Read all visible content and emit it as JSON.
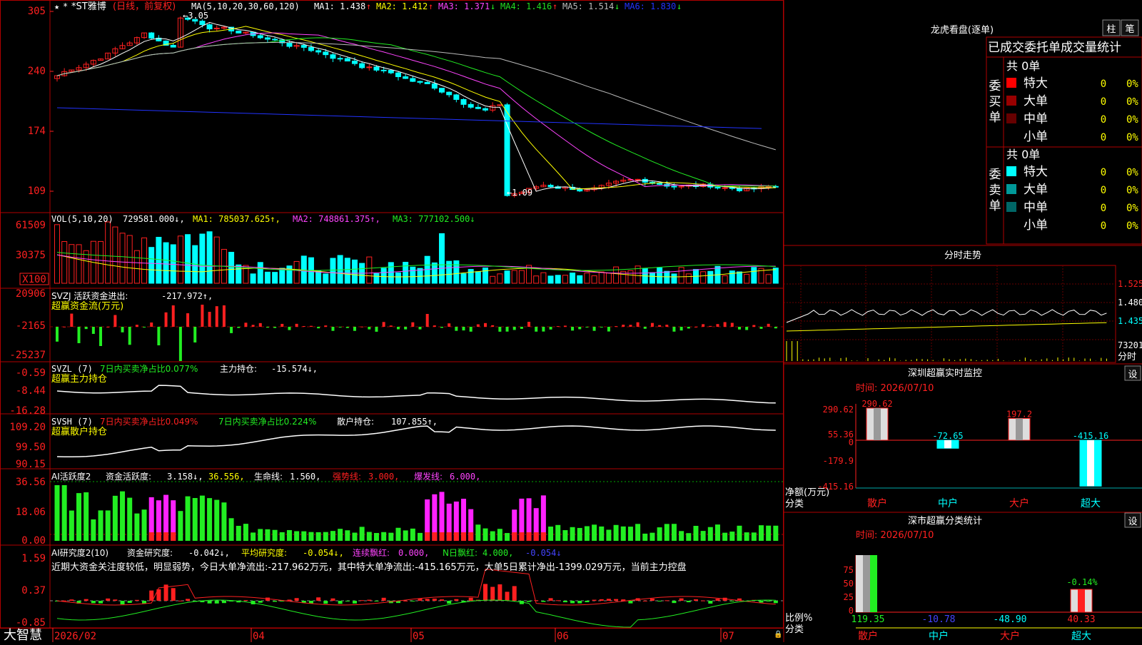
{
  "app": {
    "brand": "大智慧",
    "dates_axis": [
      "2026/02",
      "04",
      "05",
      "06",
      "07"
    ]
  },
  "kline": {
    "title": "*ST雅博",
    "period": "(日线，前复权)",
    "ma_label": "MA(5,10,20,30,60,120)",
    "ma": [
      {
        "label": "MA1:",
        "value": "1.438",
        "arrow": "↑",
        "color": "#ffffff"
      },
      {
        "label": "MA2:",
        "value": "1.412",
        "arrow": "↑",
        "color": "#ffff00"
      },
      {
        "label": "MA3:",
        "value": "1.371",
        "arrow": "↓",
        "color": "#ff44ff"
      },
      {
        "label": "MA4:",
        "value": "1.416",
        "arrow": "↑",
        "color": "#22dd22"
      },
      {
        "label": "MA5:",
        "value": "1.514",
        "arrow": "↓",
        "color": "#bbbbbb"
      },
      {
        "label": "MA6:",
        "value": "1.830",
        "arrow": "↓",
        "color": "#2233ff"
      }
    ],
    "y_ticks": [
      "305",
      "240",
      "174",
      "109"
    ],
    "high_label": "3.05",
    "low_label": "1.09",
    "up_color": "#ff2020",
    "down_color": "#00ffff"
  },
  "volume": {
    "label": "VOL(5,10,20)",
    "value": "729581.000",
    "ma1": "MA1: 785037.625",
    "ma2": "MA2: 748861.375",
    "ma3": "MA3: 777102.500",
    "y_ticks": [
      "61509",
      "30375",
      "X100"
    ]
  },
  "svzj": {
    "label": "SVZJ  活跃资金进出:",
    "value": "-217.972",
    "sub": "超赢资金流(万元)",
    "y_ticks": [
      "20906",
      "-2165",
      "-25237"
    ]
  },
  "svzl": {
    "label": "SVZL (7)",
    "text1": "7日内买卖净占比0.077%",
    "text2": "主力持仓:",
    "value": "-15.574",
    "sub": "超赢主力持仓",
    "y_ticks": [
      "-0.59",
      "-8.44",
      "-16.28"
    ]
  },
  "svsh": {
    "label": "SVSH (7)",
    "text1": "7日内买卖净占比0.049%",
    "text2": "7日内买卖净占比0.224%",
    "text3": "散户持仓:",
    "value": "107.855",
    "sub": "超赢散户持仓",
    "y_ticks": [
      "109.20",
      "99.50",
      "90.15"
    ]
  },
  "ai_active": {
    "label": "AI活跃度2",
    "t1": "资金活跃度:",
    "v1": "3.158",
    "v2": "36.556,",
    "t3": "生命线:",
    "v3": "1.560,",
    "t4": "强势线:",
    "v4": "3.000,",
    "t5": "爆发线:",
    "v5": "6.000,",
    "y_ticks": [
      "36.56",
      "18.06",
      "0.00"
    ]
  },
  "ai_research": {
    "label": "AI研究度2(10)",
    "t1": "资金研究度:",
    "v1": "-0.042",
    "t2": "平均研究度:",
    "v2": "-0.054",
    "t3": "连续飘红:",
    "v3": "0.000,",
    "t4": "N日飘红:",
    "v4": "4.000,",
    "v5": "-0.054",
    "comment": "近期大资金关注度较低，明显弱势，今日大单净流出:-217.962万元，其中特大单净流出:-415.165万元，大单5日累计净出-1399.029万元，当前主力控盘",
    "y_ticks": [
      "1.59",
      "0.37",
      "-0.85"
    ]
  },
  "dragon": {
    "title": "龙虎看盘(逐单)",
    "btn_bar": "柱",
    "btn_pen": "笔",
    "heading": "已成交委托单成交量统计",
    "buy_label": "委买单",
    "sell_label": "委卖单",
    "buy_total": "共 0单",
    "sell_total": "共 0单",
    "buy_rows": [
      {
        "name": "特大",
        "count": "0",
        "pct": "0%",
        "color": "#ff0000"
      },
      {
        "name": "大单",
        "count": "0",
        "pct": "0%",
        "color": "#990000"
      },
      {
        "name": "中单",
        "count": "0",
        "pct": "0%",
        "color": "#660000"
      },
      {
        "name": "小单",
        "count": "0",
        "pct": "0%",
        "color": ""
      }
    ],
    "sell_rows": [
      {
        "name": "特大",
        "count": "0",
        "pct": "0%",
        "color": "#00ffff"
      },
      {
        "name": "大单",
        "count": "0",
        "pct": "0%",
        "color": "#009999"
      },
      {
        "name": "中单",
        "count": "0",
        "pct": "0%",
        "color": "#006666"
      },
      {
        "name": "小单",
        "count": "0",
        "pct": "0%",
        "color": ""
      }
    ]
  },
  "intraday": {
    "title": "分时走势",
    "y_ticks": [
      "1.525",
      "1.480",
      "1.435"
    ],
    "vol_tick": "73201",
    "vol_unit": "分时"
  },
  "sz_monitor": {
    "title": "深圳超赢实时监控",
    "btn": "设",
    "time_label": "时间: 2026/07/10",
    "y_ticks": [
      "290.62",
      "55.36",
      "0",
      "-179.9",
      "-415.16"
    ],
    "y_unit": "净额(万元)",
    "x_unit": "分类",
    "categories": [
      "散户",
      "中户",
      "大户",
      "超大"
    ],
    "values": [
      290.62,
      -72.65,
      197.2,
      -415.16
    ],
    "value_labels": [
      "290.62",
      "-72.65",
      "197.2",
      "-415.16"
    ]
  },
  "sz_class": {
    "title": "深市超赢分类统计",
    "btn": "设",
    "time_label": "时间: 2026/07/10",
    "y_ticks": [
      "75",
      "50",
      "25",
      "0"
    ],
    "y_unit": "比例%",
    "x_unit": "分类",
    "categories": [
      "散户",
      "中户",
      "大户",
      "超大"
    ],
    "bottom_values": [
      "119.35",
      "-10.78",
      "-48.90",
      "40.33"
    ],
    "top_label": "-0.14%"
  },
  "chart_data": [
    {
      "type": "bar",
      "title": "深圳超赢实时监控",
      "ylabel": "净额(万元)",
      "xlabel": "分类",
      "categories": [
        "散户",
        "中户",
        "大户",
        "超大"
      ],
      "values": [
        290.62,
        -72.65,
        197.2,
        -415.16
      ],
      "ylim": [
        -415.16,
        290.62
      ]
    },
    {
      "type": "bar",
      "title": "深市超赢分类统计",
      "ylabel": "比例%",
      "xlabel": "分类",
      "categories": [
        "散户",
        "中户",
        "大户",
        "超大"
      ],
      "values": [
        119.35,
        -10.78,
        -48.9,
        40.33
      ],
      "ylim": [
        0,
        100
      ]
    }
  ]
}
